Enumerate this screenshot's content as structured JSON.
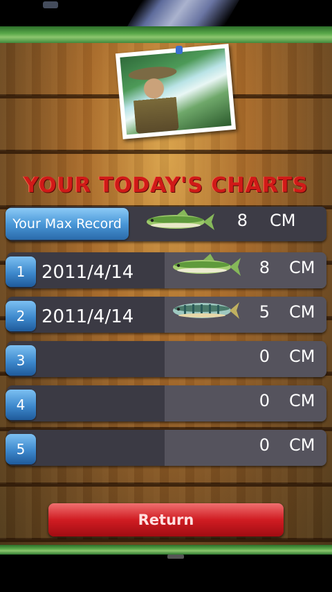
{
  "screen_title": "YOUR TODAY'S CHARTS",
  "max_record": {
    "label": "Your Max Record",
    "value": "8",
    "unit": "CM",
    "fish_icon": "green-fish-icon"
  },
  "entries": [
    {
      "rank": "1",
      "date": "2011/4/14",
      "value": "8",
      "unit": "CM",
      "fish_icon": "green-fish-icon"
    },
    {
      "rank": "2",
      "date": "2011/4/14",
      "value": "5",
      "unit": "CM",
      "fish_icon": "striped-fish-icon"
    },
    {
      "rank": "3",
      "date": "",
      "value": "0",
      "unit": "CM"
    },
    {
      "rank": "4",
      "date": "",
      "value": "0",
      "unit": "CM"
    },
    {
      "rank": "5",
      "date": "",
      "value": "0",
      "unit": "CM"
    }
  ],
  "return_label": "Return",
  "colors": {
    "title": "#d01a18",
    "rank_badge": "#3d88cc",
    "return_button": "#d01c22"
  }
}
